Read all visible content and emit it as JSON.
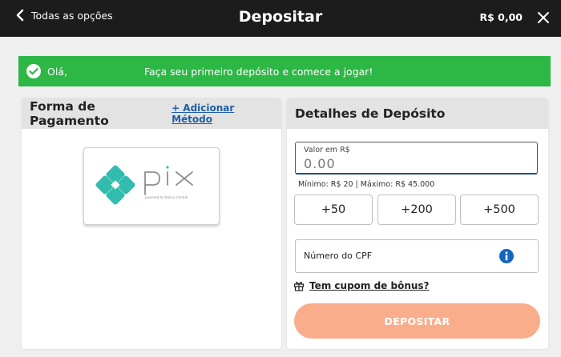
{
  "header": {
    "back_label": "Todas as opções",
    "title": "Depositar",
    "balance": "R$ 0,00"
  },
  "banner": {
    "greeting": "Olá,",
    "message": "Faça seu primeiro depósito e comece a jogar!",
    "color": "#2db745"
  },
  "payment_panel": {
    "title": "Forma de Pagamento",
    "add_method": "+ Adicionar Método",
    "method": {
      "logo_text": "pix",
      "logo_subtitle": "powered by Banco Central",
      "accent_color": "#32bcad"
    }
  },
  "deposit_panel": {
    "title": "Detalhes de Depósito",
    "amount": {
      "label": "Valor em R$",
      "placeholder": "0.00",
      "value": ""
    },
    "limits": "Mínimo: R$ 20  | Máximo: R$ 45.000",
    "quick_amounts": [
      "+50",
      "+200",
      "+500"
    ],
    "cpf_label": "Número do CPF",
    "coupon_label": "Tem cupom de bônus?",
    "submit_label": "DEPOSITAR",
    "submit_color": "#f9ad8a"
  },
  "icons": {
    "back": "chevron-left-icon",
    "close": "close-icon",
    "success": "check-circle-icon",
    "info": "info-icon",
    "gift": "gift-icon"
  }
}
